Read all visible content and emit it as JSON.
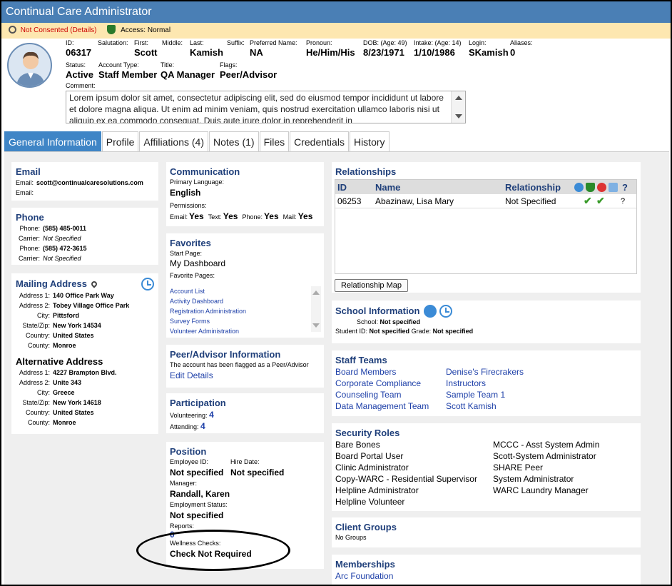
{
  "app": {
    "title": "Continual Care Administrator"
  },
  "consent": {
    "status": "Not Consented (Details)",
    "access": "Access: Normal"
  },
  "person": {
    "fields1": [
      {
        "label": "ID:",
        "value": "06317"
      },
      {
        "label": "Salutation:",
        "value": ""
      },
      {
        "label": "First:",
        "value": "Scott"
      },
      {
        "label": "Middle:",
        "value": ""
      },
      {
        "label": "Last:",
        "value": "Kamish"
      },
      {
        "label": "Suffix:",
        "value": ""
      },
      {
        "label": "Preferred Name:",
        "value": "NA"
      },
      {
        "label": "Pronoun:",
        "value": "He/Him/His"
      },
      {
        "label": "DOB: (Age: 49)",
        "value": "8/23/1971"
      },
      {
        "label": "Intake: (Age: 14)",
        "value": "1/10/1986"
      },
      {
        "label": "Login:",
        "value": "SKamish"
      },
      {
        "label": "Aliases:",
        "value": "0"
      }
    ],
    "fields2": [
      {
        "label": "Status:",
        "value": "Active"
      },
      {
        "label": "Account Type:",
        "value": "Staff Member"
      },
      {
        "label": "Title:",
        "value": "QA Manager"
      },
      {
        "label": "Flags:",
        "value": "Peer/Advisor"
      }
    ],
    "comment_label": "Comment:",
    "comment": "Lorem ipsum dolor sit amet, consectetur adipiscing elit, sed do eiusmod tempor incididunt ut labore et dolore magna aliqua. Ut enim ad minim veniam, quis nostrud exercitation ullamco laboris nisi ut aliquip ex ea commodo consequat. Duis aute irure dolor in reprehenderit in"
  },
  "tabs": [
    "General Information",
    "Profile",
    "Affiliations (4)",
    "Notes (1)",
    "Files",
    "Credentials",
    "History"
  ],
  "email": {
    "title": "Email",
    "rows": [
      {
        "label": "Email:",
        "value": "scott@continualcaresolutions.com"
      },
      {
        "label": "Email:",
        "value": ""
      }
    ]
  },
  "phone": {
    "title": "Phone",
    "rows": [
      {
        "label": "Phone:",
        "value": "(585) 485-0011"
      },
      {
        "label": "Carrier:",
        "value": "Not Specified"
      },
      {
        "label": "Phone:",
        "value": "(585) 472-3615"
      },
      {
        "label": "Carrier:",
        "value": "Not Specified"
      }
    ]
  },
  "mailing": {
    "title": "Mailing Address",
    "rows": [
      {
        "label": "Address 1:",
        "value": "140 Office Park Way"
      },
      {
        "label": "Address 2:",
        "value": "Tobey Village Office Park"
      },
      {
        "label": "City:",
        "value": "Pittsford"
      },
      {
        "label": "State/Zip:",
        "value": "New York  14534"
      },
      {
        "label": "Country:",
        "value": "United States"
      },
      {
        "label": "County:",
        "value": "Monroe"
      }
    ]
  },
  "alternative": {
    "title": "Alternative Address",
    "rows": [
      {
        "label": "Address 1:",
        "value": "4227 Brampton Blvd."
      },
      {
        "label": "Address 2:",
        "value": "Unite 343"
      },
      {
        "label": "City:",
        "value": "Greece"
      },
      {
        "label": "State/Zip:",
        "value": "New York  14618"
      },
      {
        "label": "Country:",
        "value": "United States"
      },
      {
        "label": "County:",
        "value": "Monroe"
      }
    ]
  },
  "communication": {
    "title": "Communication",
    "lang_label": "Primary Language:",
    "lang": "English",
    "perm_label": "Permissions:",
    "perms": [
      {
        "label": "Email:",
        "value": "Yes"
      },
      {
        "label": "Text:",
        "value": "Yes"
      },
      {
        "label": "Phone:",
        "value": "Yes"
      },
      {
        "label": "Mail:",
        "value": "Yes"
      }
    ]
  },
  "favorites": {
    "title": "Favorites",
    "start_label": "Start Page:",
    "start": "My Dashboard",
    "pages_label": "Favorite Pages:",
    "pages": [
      "Account List",
      "Activity Dashboard",
      "Registration Administration",
      "Survey Forms",
      "Volunteer Administration"
    ]
  },
  "peer": {
    "title": "Peer/Advisor Information",
    "text": "The account has been flagged as a Peer/Advisor",
    "link": "Edit Details"
  },
  "participation": {
    "title": "Participation",
    "vol_label": "Volunteering:",
    "vol": "4",
    "att_label": "Attending:",
    "att": "4"
  },
  "position": {
    "title": "Position",
    "emp_label": "Employee ID:",
    "emp": "Not specified",
    "hire_label": "Hire Date:",
    "hire": "Not specified",
    "mgr_label": "Manager:",
    "mgr": "Randall, Karen",
    "status_label": "Employment Status:",
    "status": "Not specified",
    "reports_label": "Reports:",
    "reports": "0",
    "wellness_label": "Wellness Checks:",
    "wellness": "Check Not Required"
  },
  "relationships": {
    "title": "Relationships",
    "headers": [
      "ID",
      "Name",
      "Relationship"
    ],
    "help": "?",
    "rows": [
      {
        "id": "06253",
        "name": "Abazinaw, Lisa Mary",
        "rel": "Not Specified",
        "c1": "✔",
        "c2": "✔",
        "q": "?"
      }
    ],
    "map_button": "Relationship Map"
  },
  "school": {
    "title": "School Information",
    "school_label": "School:",
    "school": "Not specified",
    "sid_label": "Student ID:",
    "sid": "Not specified",
    "grade_label": "Grade:",
    "grade": "Not specified"
  },
  "staff_teams": {
    "title": "Staff Teams",
    "col1": [
      "Board Members",
      "Corporate Compliance",
      "Counseling Team",
      "Data Management Team"
    ],
    "col2": [
      "Denise's Firecrakers",
      "Instructors",
      "Sample Team 1",
      "Scott Kamish"
    ]
  },
  "security": {
    "title": "Security Roles",
    "col1": [
      "Bare Bones",
      "Board Portal User",
      "Clinic Administrator",
      "Copy-WARC - Residential Supervisor",
      "Helpline Administrator",
      "Helpline Volunteer"
    ],
    "col2": [
      "MCCC - Asst System Admin",
      "Scott-System Administrator",
      "SHARE Peer",
      "System Administrator",
      "WARC Laundry Manager"
    ]
  },
  "client_groups": {
    "title": "Client Groups",
    "text": "No Groups"
  },
  "memberships": {
    "title": "Memberships",
    "items": [
      "Arc Foundation"
    ]
  },
  "colors": {
    "titlebar": "#4a7fb5",
    "consent_bg": "#fde7b0",
    "heading": "#1f3f7a",
    "link": "#1d3fa8",
    "tab_active": "#3f85c6"
  },
  "icons": [
    "ring-icon",
    "shield-icon",
    "avatar-icon",
    "map-pin-icon",
    "clock-icon",
    "document-icon",
    "check-icon"
  ]
}
